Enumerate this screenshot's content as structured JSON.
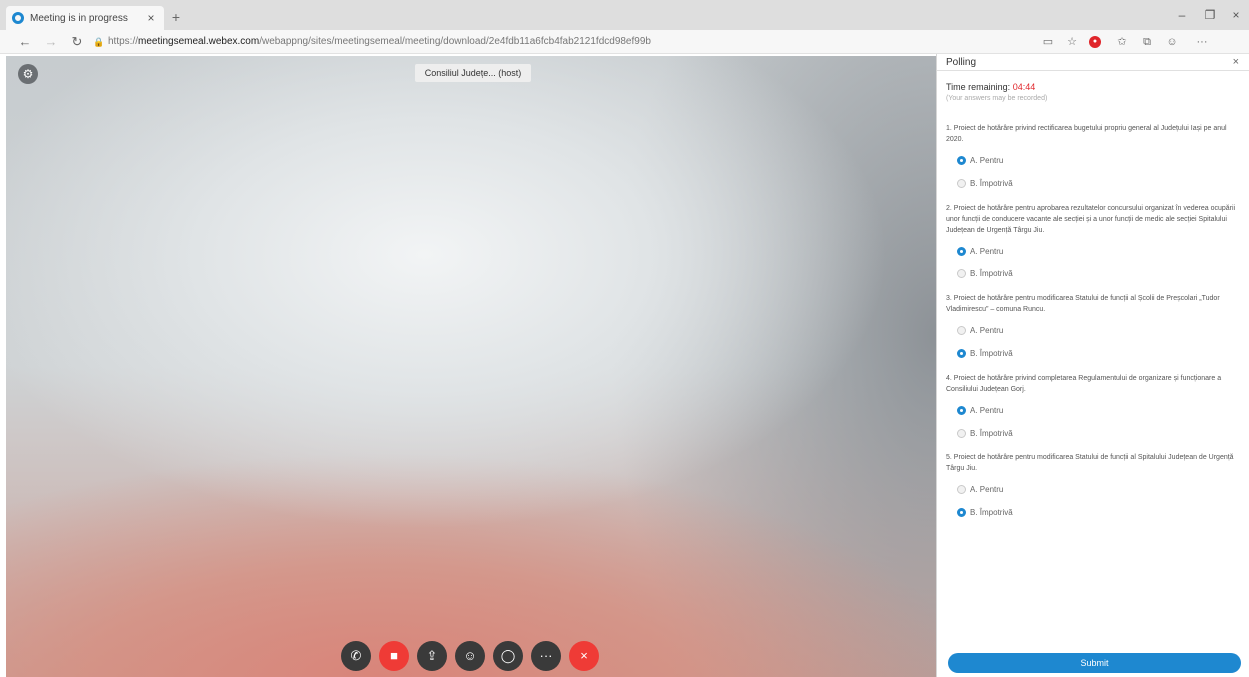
{
  "browser": {
    "tab_title": "Meeting is in progress",
    "tab_close": "×",
    "new_tab": "+",
    "window_controls": {
      "minimize": "–",
      "restore": "❐",
      "close": "×"
    },
    "nav": {
      "back": "←",
      "forward": "→",
      "reload": "↻",
      "lock": "🔒"
    },
    "url_prefix": "https://",
    "url_host": "meetingsemeal.webex.com",
    "url_path": "/webappng/sites/meetingsemeal/meeting/download/2e4fdb11a6fcb4fab2121fdcd98ef99b",
    "toolbar_icons": [
      "reader-icon",
      "star-icon",
      "extension-icon",
      "favorites-icon",
      "collections-icon",
      "profile-icon",
      "more-icon"
    ],
    "toolbar_glyphs": {
      "reader": "▭",
      "star": "☆",
      "extension": "●",
      "favorites": "✩",
      "collections": "⧉",
      "profile": "☺",
      "more": "···"
    }
  },
  "video": {
    "settings_glyph": "⚙",
    "name_badge": "Consiliul Județe... (host)",
    "controls": [
      {
        "name": "audio-button",
        "glyph": "✆",
        "red": false
      },
      {
        "name": "video-button",
        "glyph": "■",
        "red": true
      },
      {
        "name": "share-button",
        "glyph": "⇪",
        "red": false
      },
      {
        "name": "participants-button",
        "glyph": "☺",
        "red": false
      },
      {
        "name": "chat-button",
        "glyph": "◯",
        "red": false
      },
      {
        "name": "more-button",
        "glyph": "···",
        "red": false
      },
      {
        "name": "leave-button",
        "glyph": "×",
        "red": true
      }
    ]
  },
  "poll": {
    "title": "Polling",
    "close": "×",
    "time_label": "Time remaining:",
    "time_value": "04:44",
    "time_sub": "(Your answers may be recorded)",
    "questions": [
      {
        "text": "1. Proiect de hotărâre privind rectificarea bugetului propriu general al Județului Iași pe anul 2020.",
        "options": [
          {
            "label": "A. Pentru",
            "checked": true
          },
          {
            "label": "B. Împotrivă",
            "checked": false
          }
        ]
      },
      {
        "text": "2. Proiect de hotărâre pentru aprobarea rezultatelor concursului organizat în vederea ocupării unor funcții de conducere vacante ale secției și a unor funcții de medic ale secției Spitalului Județean de Urgență Târgu Jiu.",
        "options": [
          {
            "label": "A. Pentru",
            "checked": true
          },
          {
            "label": "B. Împotrivă",
            "checked": false
          }
        ]
      },
      {
        "text": "3. Proiect de hotărâre pentru modificarea Statului de funcții al Școlii de Preșcolari „Tudor Vladimirescu” – comuna Runcu.",
        "options": [
          {
            "label": "A. Pentru",
            "checked": false
          },
          {
            "label": "B. Împotrivă",
            "checked": true
          }
        ]
      },
      {
        "text": "4. Proiect de hotărâre privind completarea Regulamentului de organizare și funcționare a Consiliului Județean Gorj.",
        "options": [
          {
            "label": "A. Pentru",
            "checked": true
          },
          {
            "label": "B. Împotrivă",
            "checked": false
          }
        ]
      },
      {
        "text": "5. Proiect de hotărâre pentru modificarea Statului de funcții al Spitalului Județean de Urgență Târgu Jiu.",
        "options": [
          {
            "label": "A. Pentru",
            "checked": false
          },
          {
            "label": "B. Împotrivă",
            "checked": true
          }
        ]
      }
    ],
    "submit_label": "Submit"
  }
}
